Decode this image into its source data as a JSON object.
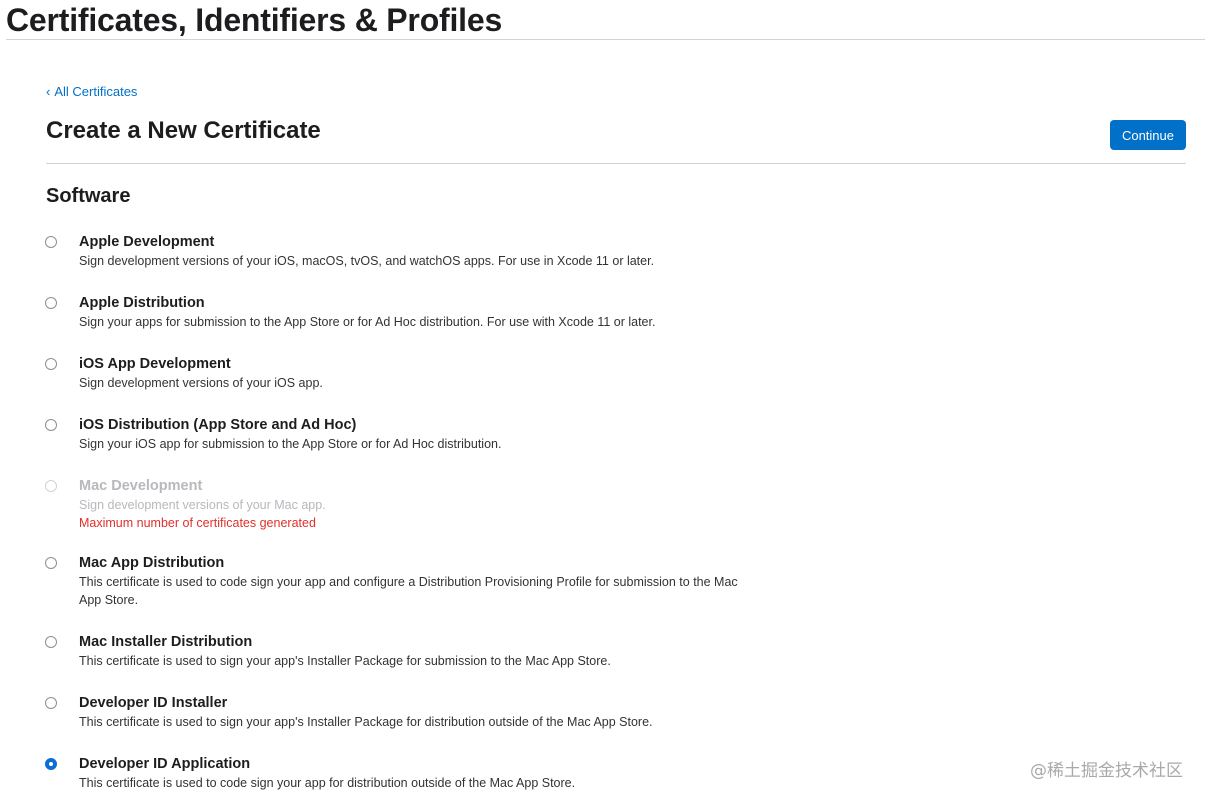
{
  "header": {
    "title": "Certificates, Identifiers & Profiles"
  },
  "nav": {
    "back_link": "All Certificates"
  },
  "main": {
    "title": "Create a New Certificate",
    "continue_label": "Continue",
    "section_title": "Software",
    "options": [
      {
        "title": "Apple Development",
        "description": "Sign development versions of your iOS, macOS, tvOS, and watchOS apps. For use in Xcode 11 or later.",
        "selected": false,
        "disabled": false
      },
      {
        "title": "Apple Distribution",
        "description": "Sign your apps for submission to the App Store or for Ad Hoc distribution. For use with Xcode 11 or later.",
        "selected": false,
        "disabled": false
      },
      {
        "title": "iOS App Development",
        "description": "Sign development versions of your iOS app.",
        "selected": false,
        "disabled": false
      },
      {
        "title": "iOS Distribution (App Store and Ad Hoc)",
        "description": "Sign your iOS app for submission to the App Store or for Ad Hoc distribution.",
        "selected": false,
        "disabled": false
      },
      {
        "title": "Mac Development",
        "description": "Sign development versions of your Mac app.",
        "warning": "Maximum number of certificates generated",
        "selected": false,
        "disabled": true
      },
      {
        "title": "Mac App Distribution",
        "description": "This certificate is used to code sign your app and configure a Distribution Provisioning Profile for submission to the Mac App Store.",
        "selected": false,
        "disabled": false
      },
      {
        "title": "Mac Installer Distribution",
        "description": "This certificate is used to sign your app's Installer Package for submission to the Mac App Store.",
        "selected": false,
        "disabled": false
      },
      {
        "title": "Developer ID Installer",
        "description": "This certificate is used to sign your app's Installer Package for distribution outside of the Mac App Store.",
        "selected": false,
        "disabled": false
      },
      {
        "title": "Developer ID Application",
        "description": "This certificate is used to code sign your app for distribution outside of the Mac App Store.",
        "selected": true,
        "disabled": false
      }
    ]
  },
  "watermark": "@稀土掘金技术社区",
  "colors": {
    "accent": "#0070c9",
    "warning": "#e0302b",
    "disabled_text": "#b8b8bd"
  }
}
